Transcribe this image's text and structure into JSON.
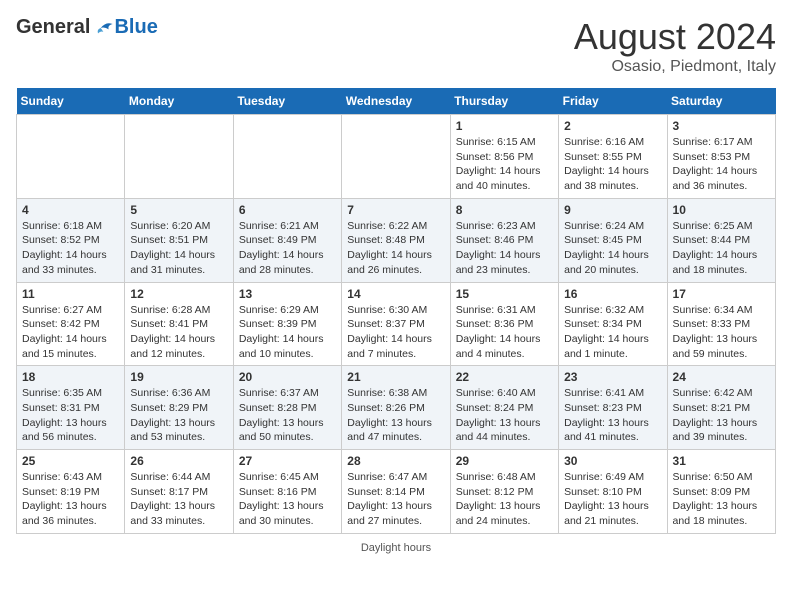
{
  "logo": {
    "general": "General",
    "blue": "Blue"
  },
  "title": "August 2024",
  "subtitle": "Osasio, Piedmont, Italy",
  "days_of_week": [
    "Sunday",
    "Monday",
    "Tuesday",
    "Wednesday",
    "Thursday",
    "Friday",
    "Saturday"
  ],
  "footer": "Daylight hours",
  "weeks": [
    [
      {
        "day": "",
        "info": ""
      },
      {
        "day": "",
        "info": ""
      },
      {
        "day": "",
        "info": ""
      },
      {
        "day": "",
        "info": ""
      },
      {
        "day": "1",
        "info": "Sunrise: 6:15 AM\nSunset: 8:56 PM\nDaylight: 14 hours and 40 minutes."
      },
      {
        "day": "2",
        "info": "Sunrise: 6:16 AM\nSunset: 8:55 PM\nDaylight: 14 hours and 38 minutes."
      },
      {
        "day": "3",
        "info": "Sunrise: 6:17 AM\nSunset: 8:53 PM\nDaylight: 14 hours and 36 minutes."
      }
    ],
    [
      {
        "day": "4",
        "info": "Sunrise: 6:18 AM\nSunset: 8:52 PM\nDaylight: 14 hours and 33 minutes."
      },
      {
        "day": "5",
        "info": "Sunrise: 6:20 AM\nSunset: 8:51 PM\nDaylight: 14 hours and 31 minutes."
      },
      {
        "day": "6",
        "info": "Sunrise: 6:21 AM\nSunset: 8:49 PM\nDaylight: 14 hours and 28 minutes."
      },
      {
        "day": "7",
        "info": "Sunrise: 6:22 AM\nSunset: 8:48 PM\nDaylight: 14 hours and 26 minutes."
      },
      {
        "day": "8",
        "info": "Sunrise: 6:23 AM\nSunset: 8:46 PM\nDaylight: 14 hours and 23 minutes."
      },
      {
        "day": "9",
        "info": "Sunrise: 6:24 AM\nSunset: 8:45 PM\nDaylight: 14 hours and 20 minutes."
      },
      {
        "day": "10",
        "info": "Sunrise: 6:25 AM\nSunset: 8:44 PM\nDaylight: 14 hours and 18 minutes."
      }
    ],
    [
      {
        "day": "11",
        "info": "Sunrise: 6:27 AM\nSunset: 8:42 PM\nDaylight: 14 hours and 15 minutes."
      },
      {
        "day": "12",
        "info": "Sunrise: 6:28 AM\nSunset: 8:41 PM\nDaylight: 14 hours and 12 minutes."
      },
      {
        "day": "13",
        "info": "Sunrise: 6:29 AM\nSunset: 8:39 PM\nDaylight: 14 hours and 10 minutes."
      },
      {
        "day": "14",
        "info": "Sunrise: 6:30 AM\nSunset: 8:37 PM\nDaylight: 14 hours and 7 minutes."
      },
      {
        "day": "15",
        "info": "Sunrise: 6:31 AM\nSunset: 8:36 PM\nDaylight: 14 hours and 4 minutes."
      },
      {
        "day": "16",
        "info": "Sunrise: 6:32 AM\nSunset: 8:34 PM\nDaylight: 14 hours and 1 minute."
      },
      {
        "day": "17",
        "info": "Sunrise: 6:34 AM\nSunset: 8:33 PM\nDaylight: 13 hours and 59 minutes."
      }
    ],
    [
      {
        "day": "18",
        "info": "Sunrise: 6:35 AM\nSunset: 8:31 PM\nDaylight: 13 hours and 56 minutes."
      },
      {
        "day": "19",
        "info": "Sunrise: 6:36 AM\nSunset: 8:29 PM\nDaylight: 13 hours and 53 minutes."
      },
      {
        "day": "20",
        "info": "Sunrise: 6:37 AM\nSunset: 8:28 PM\nDaylight: 13 hours and 50 minutes."
      },
      {
        "day": "21",
        "info": "Sunrise: 6:38 AM\nSunset: 8:26 PM\nDaylight: 13 hours and 47 minutes."
      },
      {
        "day": "22",
        "info": "Sunrise: 6:40 AM\nSunset: 8:24 PM\nDaylight: 13 hours and 44 minutes."
      },
      {
        "day": "23",
        "info": "Sunrise: 6:41 AM\nSunset: 8:23 PM\nDaylight: 13 hours and 41 minutes."
      },
      {
        "day": "24",
        "info": "Sunrise: 6:42 AM\nSunset: 8:21 PM\nDaylight: 13 hours and 39 minutes."
      }
    ],
    [
      {
        "day": "25",
        "info": "Sunrise: 6:43 AM\nSunset: 8:19 PM\nDaylight: 13 hours and 36 minutes."
      },
      {
        "day": "26",
        "info": "Sunrise: 6:44 AM\nSunset: 8:17 PM\nDaylight: 13 hours and 33 minutes."
      },
      {
        "day": "27",
        "info": "Sunrise: 6:45 AM\nSunset: 8:16 PM\nDaylight: 13 hours and 30 minutes."
      },
      {
        "day": "28",
        "info": "Sunrise: 6:47 AM\nSunset: 8:14 PM\nDaylight: 13 hours and 27 minutes."
      },
      {
        "day": "29",
        "info": "Sunrise: 6:48 AM\nSunset: 8:12 PM\nDaylight: 13 hours and 24 minutes."
      },
      {
        "day": "30",
        "info": "Sunrise: 6:49 AM\nSunset: 8:10 PM\nDaylight: 13 hours and 21 minutes."
      },
      {
        "day": "31",
        "info": "Sunrise: 6:50 AM\nSunset: 8:09 PM\nDaylight: 13 hours and 18 minutes."
      }
    ]
  ]
}
